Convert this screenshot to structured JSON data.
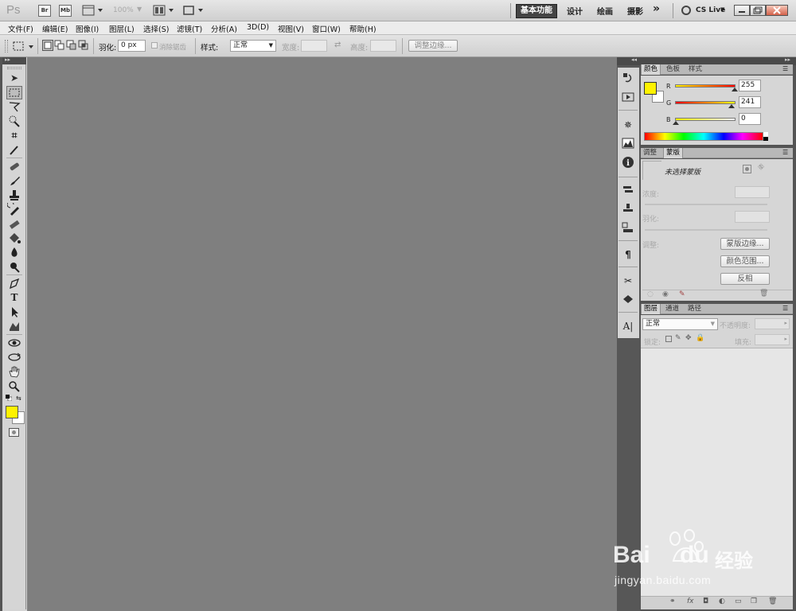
{
  "app": {
    "logo": "Ps",
    "bridge_btn": "Br",
    "minibridge_btn": "Mb",
    "zoom": "100%",
    "workspaces": {
      "active": "基本功能",
      "others": [
        "设计",
        "绘画",
        "摄影"
      ],
      "more": "»"
    },
    "cs_live": "CS Live"
  },
  "menu": [
    "文件(F)",
    "编辑(E)",
    "图像(I)",
    "图层(L)",
    "选择(S)",
    "滤镜(T)",
    "分析(A)",
    "3D(D)",
    "视图(V)",
    "窗口(W)",
    "帮助(H)"
  ],
  "options": {
    "feather_label": "羽化:",
    "feather_value": "0 px",
    "antialias_label": "消除锯齿",
    "style_label": "样式:",
    "style_value": "正常",
    "width_label": "宽度:",
    "height_label": "高度:",
    "refine_edge": "调整边缘..."
  },
  "color_panel": {
    "tabs": [
      "颜色",
      "色板",
      "样式"
    ],
    "foreground": "#fff200",
    "channels": [
      {
        "label": "R",
        "value": "255",
        "fraction": 1.0
      },
      {
        "label": "G",
        "value": "241",
        "fraction": 0.945
      },
      {
        "label": "B",
        "value": "0",
        "fraction": 0.0
      }
    ]
  },
  "masks_panel": {
    "tabs": [
      "调整",
      "蒙版"
    ],
    "no_mask": "未选择蒙版",
    "density": "浓度:",
    "feather": "羽化:",
    "refine": "调整:",
    "mask_edge_btn": "蒙版边缘...",
    "color_range_btn": "颜色范围...",
    "invert_btn": "反相"
  },
  "layers_panel": {
    "tabs": [
      "图层",
      "通道",
      "路径"
    ],
    "blend_mode": "正常",
    "opacity_label": "不透明度:",
    "lock_label": "锁定:",
    "fill_label": "填充:"
  },
  "watermark": {
    "brand": "Bai",
    "brand_suffix": "du",
    "cn": "经验",
    "url": "jingyan.baidu.com"
  }
}
